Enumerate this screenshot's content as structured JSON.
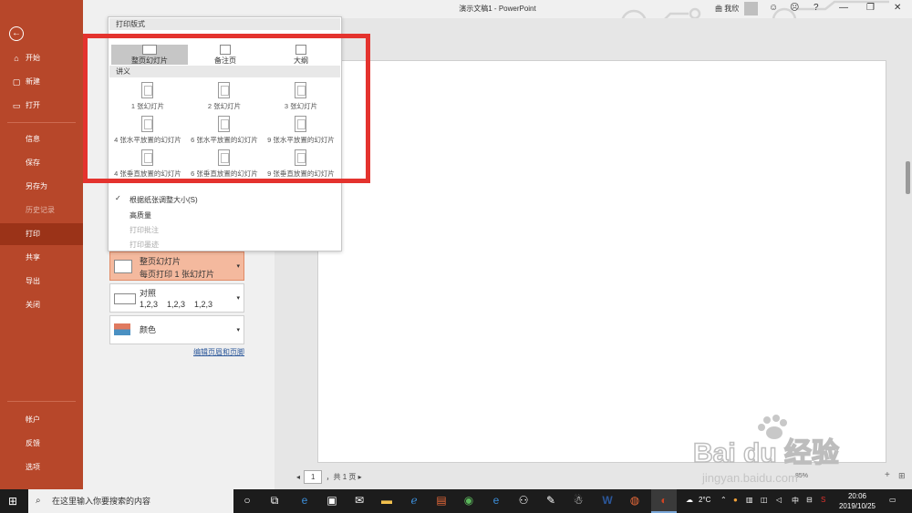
{
  "window": {
    "title": "演示文稿1 - PowerPoint",
    "user_name": "曲 我欣",
    "help": "?",
    "buttons": {
      "minimize": "—",
      "restore": "❐",
      "close": "✕"
    }
  },
  "sidebar": {
    "back_icon": "←",
    "items": [
      {
        "icon": "⌂",
        "label": "开始"
      },
      {
        "icon": "▢",
        "label": "新建"
      },
      {
        "icon": "▭",
        "label": "打开"
      },
      {
        "label": "信息"
      },
      {
        "label": "保存"
      },
      {
        "label": "另存为"
      },
      {
        "label": "历史记录"
      },
      {
        "label": "打印"
      },
      {
        "label": "共享"
      },
      {
        "label": "导出"
      },
      {
        "label": "关闭"
      },
      {
        "label": "帐户"
      },
      {
        "label": "反馈"
      },
      {
        "label": "选项"
      }
    ]
  },
  "dropdown": {
    "header": "打印版式",
    "layouts": [
      {
        "label": "整页幻灯片"
      },
      {
        "label": "备注页"
      },
      {
        "label": "大纲"
      }
    ],
    "handout_header": "讲义",
    "handouts": [
      {
        "label": "1 张幻灯片"
      },
      {
        "label": "2 张幻灯片"
      },
      {
        "label": "3 张幻灯片"
      },
      {
        "label": "4 张水平放置的幻灯片"
      },
      {
        "label": "6 张水平放置的幻灯片"
      },
      {
        "label": "9 张水平放置的幻灯片"
      },
      {
        "label": "4 张垂直放置的幻灯片"
      },
      {
        "label": "6 张垂直放置的幻灯片"
      },
      {
        "label": "9 张垂直放置的幻灯片"
      }
    ],
    "options": [
      {
        "label": "根据纸张调整大小(S)",
        "checked": true
      },
      {
        "label": "高质量"
      },
      {
        "label": "打印批注"
      },
      {
        "label": "打印墨迹"
      }
    ],
    "checkmark": "✓"
  },
  "settings": {
    "layout": {
      "title": "整页幻灯片",
      "sub": "每页打印 1 张幻灯片"
    },
    "collate": {
      "title": "对照",
      "sub": "1,2,3    1,2,3    1,2,3"
    },
    "color": {
      "title": "颜色"
    },
    "arrow": "▾",
    "edit_link": "编辑页眉和页脚"
  },
  "preview": {
    "page_value": "1",
    "page_total": "，共 1 页",
    "prev": "◂",
    "next": "▸",
    "zoom_label": "85%",
    "zoom_plus": "+",
    "fit": "⊞"
  },
  "taskbar": {
    "search_placeholder": "在这里输入你要搜索的内容",
    "start_icon": "windows-icon",
    "temp": "2°C",
    "ime": "中",
    "time": "20:06",
    "date": "2019/10/25"
  },
  "watermark": {
    "brand": "Bai du 经验",
    "url": "jingyan.baidu.com"
  },
  "colors": {
    "accent": "#b7472a",
    "selected": "#9b3318",
    "highlight": "#e4332e",
    "active_setting": "#f4b99e"
  }
}
